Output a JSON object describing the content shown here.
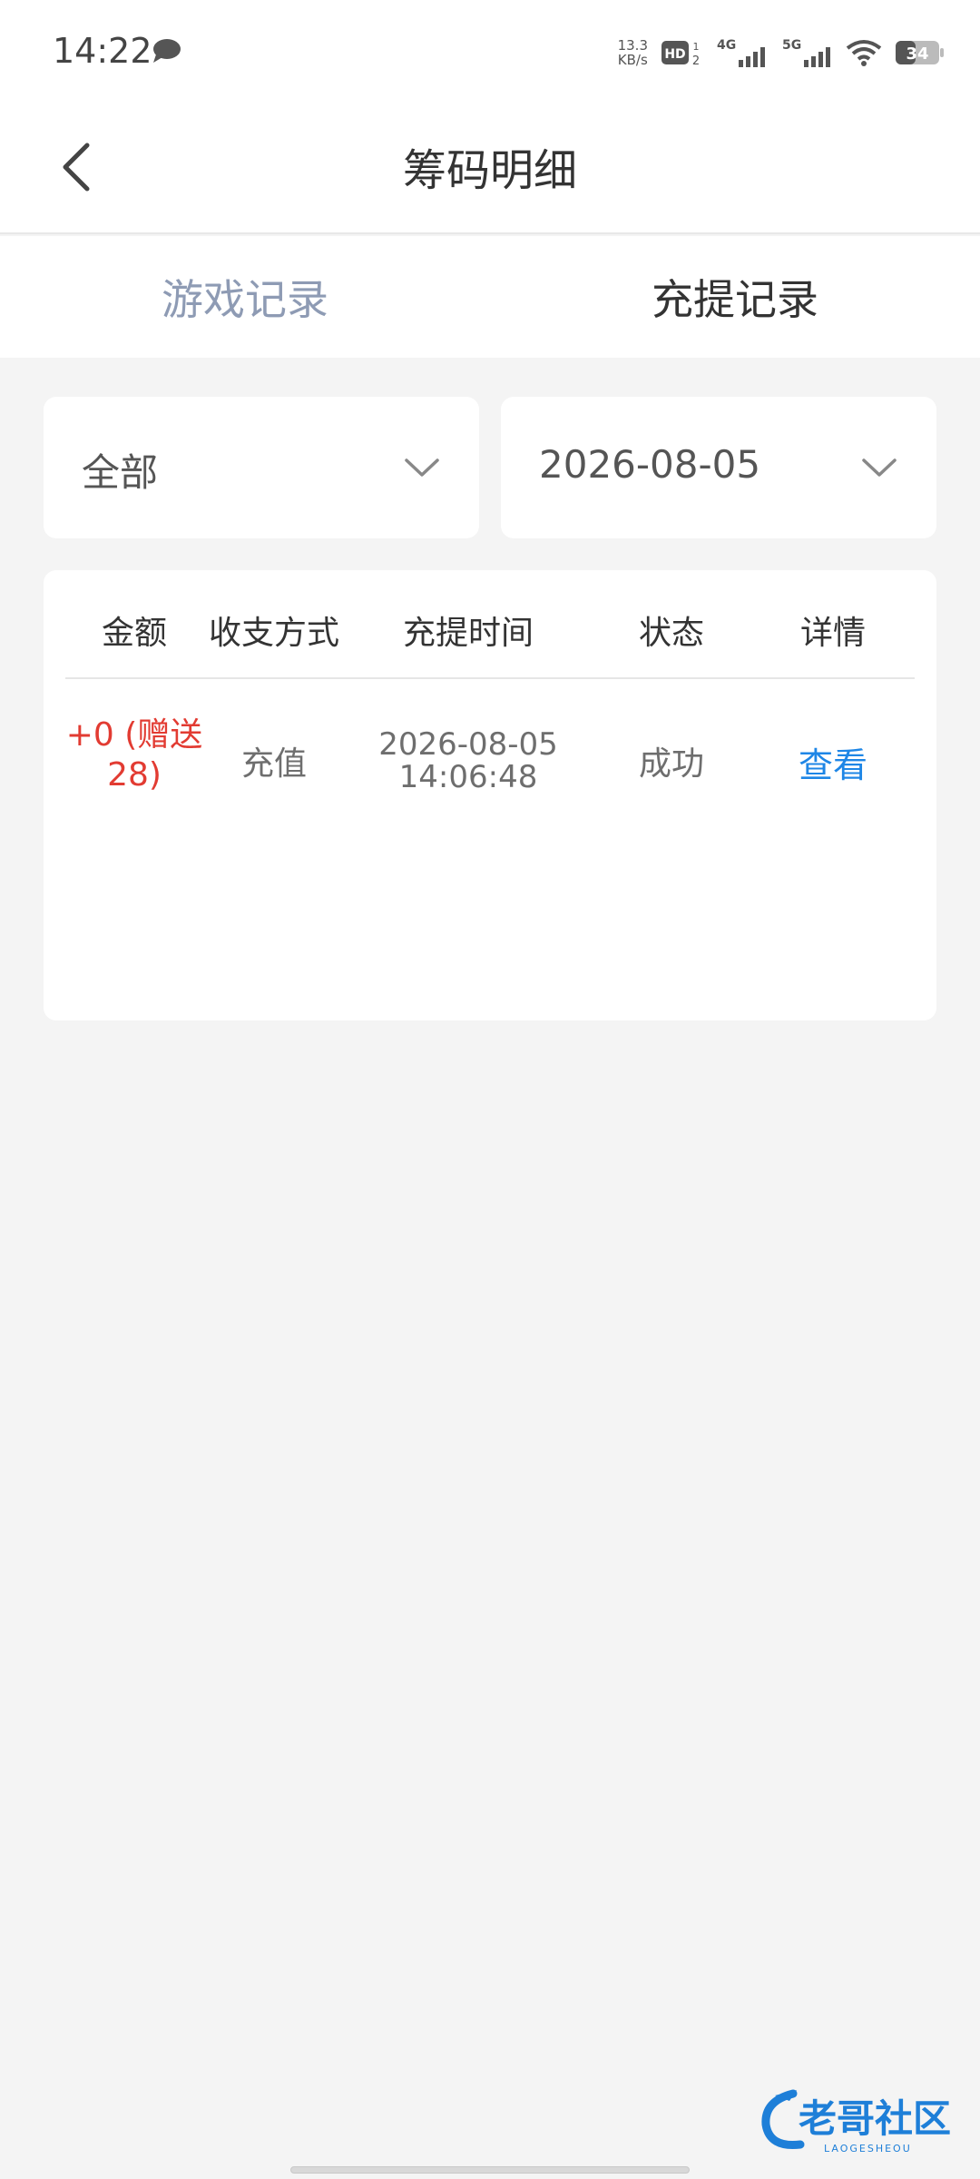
{
  "status_bar": {
    "time": "14:22",
    "net_speed_value": "13.3",
    "net_speed_unit": "KB/s",
    "net1_label": "4G",
    "net2_label": "5G",
    "battery": "34",
    "icons": [
      "message-icon",
      "hd-icon",
      "signal-4g-icon",
      "signal-5g-icon",
      "wifi-icon",
      "battery-icon"
    ]
  },
  "header": {
    "title": "筹码明细",
    "back_icon": "chevron-left-icon"
  },
  "tabs": [
    {
      "label": "游戏记录",
      "active": false
    },
    {
      "label": "充提记录",
      "active": true
    }
  ],
  "filters": {
    "type": {
      "value": "全部",
      "icon": "chevron-down-icon"
    },
    "date": {
      "value": "2026-08-05",
      "icon": "chevron-down-icon"
    }
  },
  "table": {
    "columns": [
      "金额",
      "收支方式",
      "充提时间",
      "状态",
      "详情"
    ],
    "rows": [
      {
        "amount_line1": "+0 (赠送",
        "amount_line2": "28)",
        "method": "充值",
        "date": "2026-08-05",
        "time": "14:06:48",
        "status": "成功",
        "detail": "查看"
      }
    ]
  },
  "colors": {
    "amount_red": "#e23b32",
    "link_blue": "#1e86e6",
    "tab_inactive": "#8e9bb4",
    "background": "#f4f4f4"
  }
}
